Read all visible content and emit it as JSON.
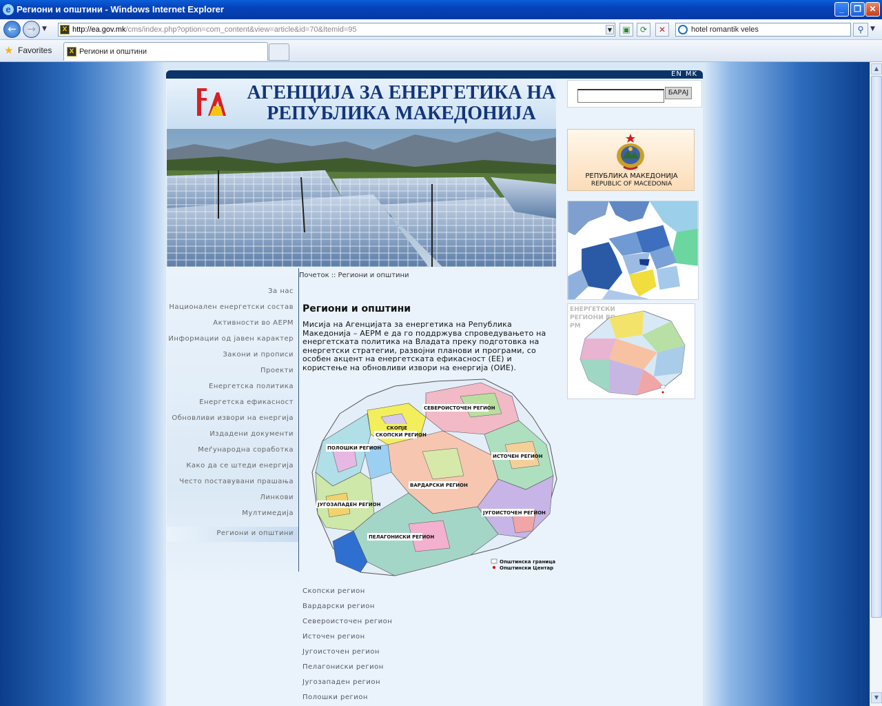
{
  "window": {
    "title": "Региони и општини - Windows Internet Explorer"
  },
  "browser": {
    "url_domain": "http://ea.gov.mk",
    "url_path": "/cms/index.php?option=com_content&view=article&id=70&Itemid=95",
    "search_text": "hotel romantik veles",
    "favorites_label": "Favorites",
    "tab_title": "Региони и општини"
  },
  "site": {
    "lang": [
      "EN",
      "MK"
    ],
    "agency_line1": "АГЕНЦИЈА ЗА ЕНЕРГЕТИКА НА",
    "agency_line2": "РЕПУБЛИКА МАКЕДОНИЈА",
    "search_button": "БАРАЈ",
    "coat_line1": "РЕПУБЛИКА МАКЕДОНИЈА",
    "coat_line2": "REPUBLIC OF MACEDONIA",
    "regmap_caption": "ЕНЕРГЕТСКИ РЕГИОНИ ВО РМ"
  },
  "nav": {
    "items": [
      "За нас",
      "Национален енергетски состав",
      "Активности во АЕРМ",
      "Информации од јавен карактер",
      "Закони и прописи",
      "Проекти",
      "Енергетска политика",
      "Енергетска ефикасност",
      "Обновливи извори на енергија",
      "Издадени документи",
      "Меѓународна соработка",
      "Како да се штеди енергија",
      "Често поставувани прашања",
      "Линкови",
      "Мултимедија"
    ],
    "active": "Региони и општини"
  },
  "breadcrumb": {
    "home": "Почеток",
    "sep": "::",
    "current": "Региони и општини"
  },
  "article": {
    "title": "Региони и општини",
    "body": "Мисија на Агенцијата за енергетика на Република Македонија – АЕРМ е да го поддржува спроведувањето на енергетската политика на Владата преку подготовка на енергетски стратегии, развојни планови и програми, со особен акцент на енергетската ефикасност (ЕЕ) и користење на обновливи извори на енергија (ОИЕ).",
    "map_labels": {
      "north_east": "СЕВЕРОИСТОЧЕН РЕГИОН",
      "skopje_city": "СКОПЈЕ",
      "skopje": "СКОПСКИ РЕГИОН",
      "polog": "ПОЛОШКИ РЕГИОН",
      "east": "ИСТОЧЕН РЕГИОН",
      "vardar": "ВАРДАРСКИ РЕГИОН",
      "south_west": "ЈУГОЗАПАДЕН РЕГИОН",
      "south_east": "ЈУГОИСТОЧЕН РЕГИОН",
      "pelagonia": "ПЕЛАГОНИСКИ РЕГИОН",
      "legend_border": "Општинска граница",
      "legend_center": "Општински Центар"
    },
    "region_links": [
      "Скопски регион",
      "Вардарски регион",
      "Североисточен регион",
      "Источен регион",
      "Југоисточен регион",
      "Пелагониски регион",
      "Југозападен регион",
      "Полошки регион"
    ]
  }
}
